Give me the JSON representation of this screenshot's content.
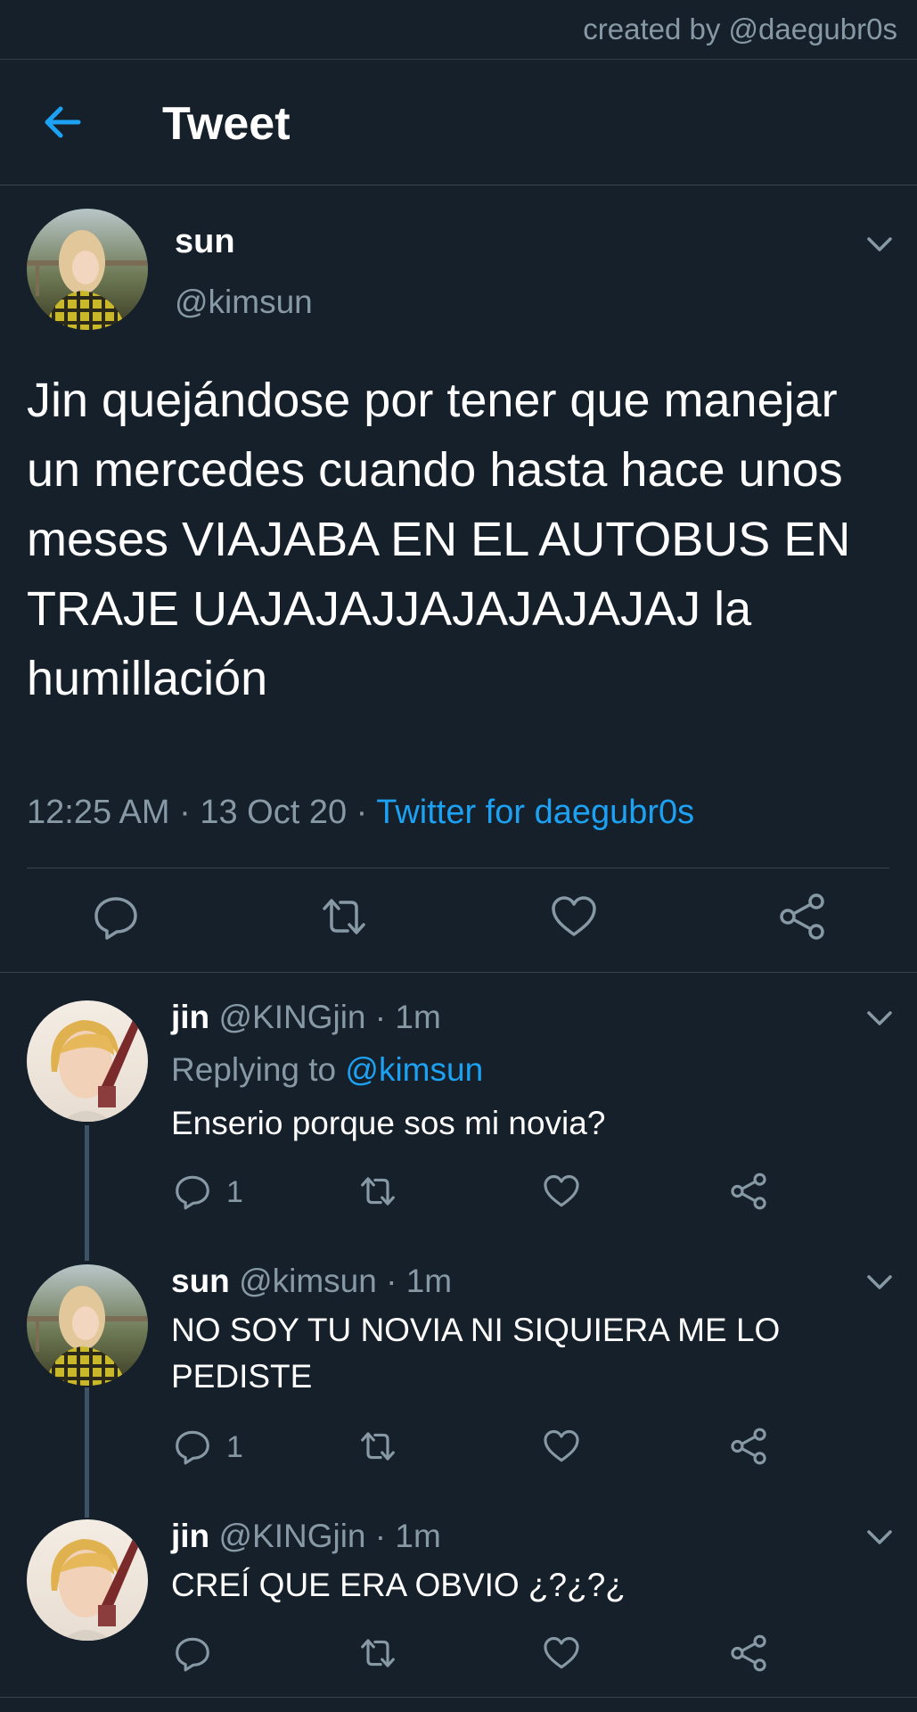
{
  "credit": "created by @daegubr0s",
  "header": {
    "title": "Tweet",
    "back_icon": "arrow-left-icon"
  },
  "main_tweet": {
    "name": "sun",
    "handle": "@kimsun",
    "text": "Jin quejándose por tener que manejar un mercedes cuando hasta hace unos meses VIAJABA EN EL AUTOBUS EN TRAJE UAJAJAJJAJAJAJAJAJ la humillación",
    "time": "12:25 AM",
    "date": "13 Oct 20",
    "source": "Twitter for daegubr0s",
    "separator": " · "
  },
  "replies": [
    {
      "name": "jin",
      "handle": "@KINGjin",
      "time": "1m",
      "replying_prefix": "Replying to",
      "replying_to": "@kimsun",
      "text": "Enserio porque sos mi novia?",
      "reply_count": "1"
    },
    {
      "name": "sun",
      "handle": "@kimsun",
      "time": "1m",
      "text": "NO SOY TU NOVIA NI SIQUIERA ME LO PEDISTE",
      "reply_count": "1"
    },
    {
      "name": "jin",
      "handle": "@KINGjin",
      "time": "1m",
      "text": "CREÍ QUE ERA OBVIO ¿?¿?¿",
      "reply_count": ""
    }
  ],
  "colors": {
    "background": "#15202b",
    "accent": "#1da1f2",
    "muted": "#8899a6",
    "divider": "#38444d"
  }
}
